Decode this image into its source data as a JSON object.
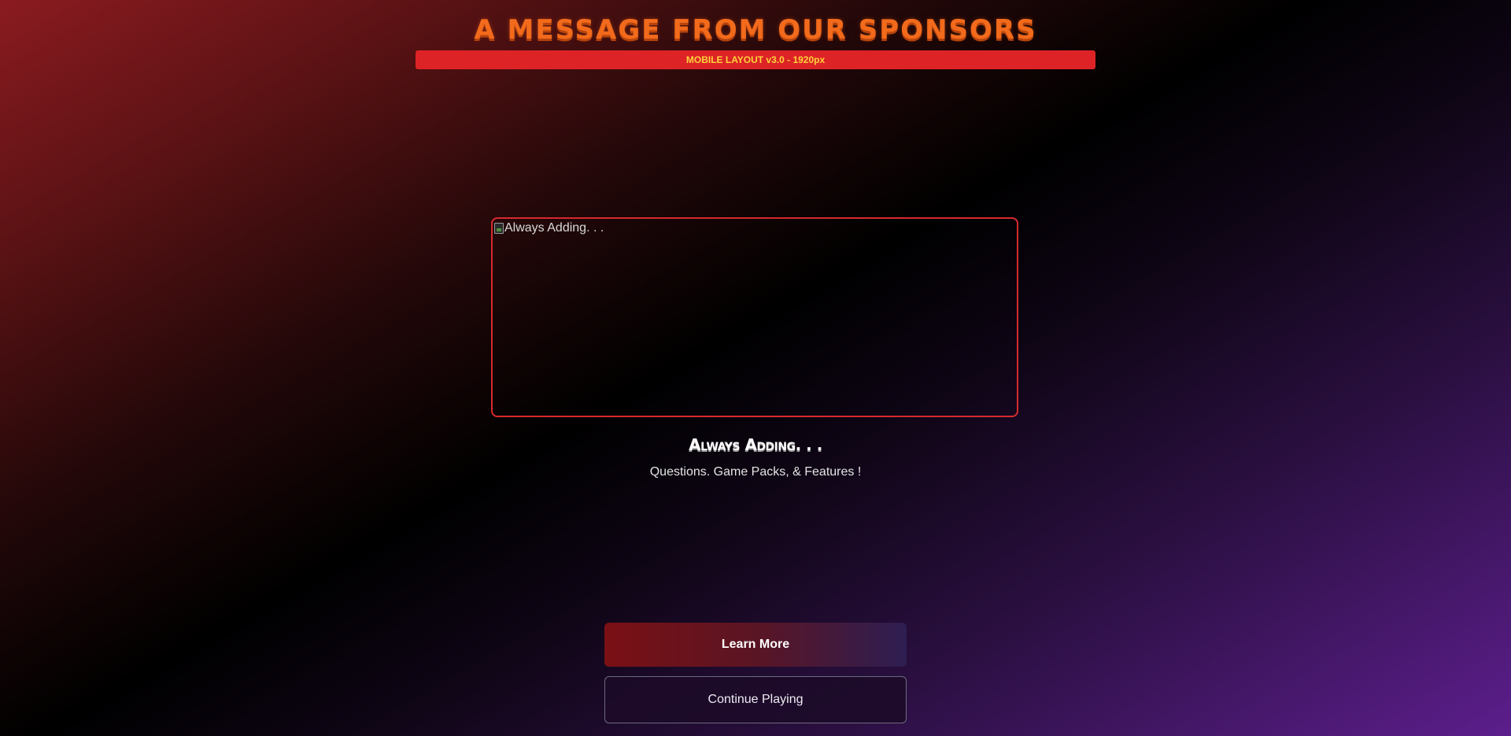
{
  "header": {
    "title": "A MESSAGE FROM OUR SPONSORS",
    "layout_banner": "MOBILE LAYOUT v3.0 - 1920px"
  },
  "ad": {
    "image_alt": "Always Adding. . .",
    "headline": "Always Adding. . .",
    "subtext": "Questions. Game Packs, & Features !"
  },
  "actions": {
    "learn_more_label": "Learn More",
    "continue_label": "Continue Playing"
  },
  "colors": {
    "title_orange": "#f26a1b",
    "banner_red": "#dd2326",
    "banner_text_yellow": "#ffd23a",
    "frame_red": "#d62a2e"
  }
}
